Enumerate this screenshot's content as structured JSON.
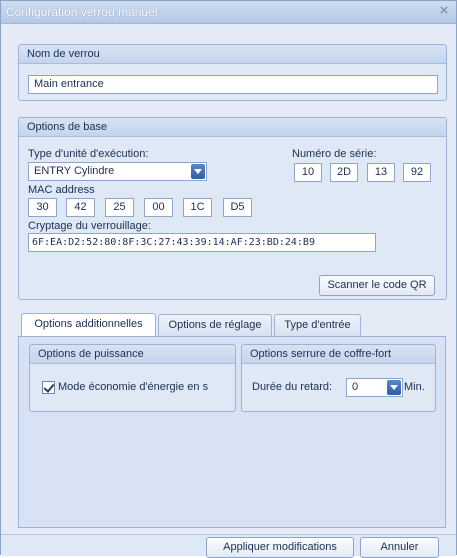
{
  "window": {
    "title": "Configuration verrou manuel",
    "close_glyph": "×"
  },
  "lock_name": {
    "header": "Nom de verrou",
    "value": "Main entrance"
  },
  "basic_options": {
    "header": "Options de base",
    "unit_type_label": "Type d'unité d'exécution:",
    "unit_type_value": "ENTRY Cylindre",
    "serial_label": "Numéro de série:",
    "serial": [
      "10",
      "2D",
      "13",
      "92"
    ],
    "mac_label": "MAC address",
    "mac": [
      "30",
      "42",
      "25",
      "00",
      "1C",
      "D5"
    ],
    "crypt_label": "Cryptage du verrouillage:",
    "crypt_value": "6F:EA:D2:52:80:8F:3C:27:43:39:14:AF:23:BD:24:B9",
    "scan_button": "Scanner le code QR"
  },
  "tabs": [
    {
      "label": "Options additionnelles",
      "active": true
    },
    {
      "label": "Options de réglage",
      "active": false
    },
    {
      "label": "Type d'entrée",
      "active": false
    }
  ],
  "power_options": {
    "header": "Options de puissance",
    "energy_saving_label": "Mode économie d'énergie en s",
    "energy_saving_checked": true
  },
  "safe_options": {
    "header": "Options serrure de coffre-fort",
    "delay_label": "Durée du retard:",
    "delay_value": "0",
    "unit": "Min."
  },
  "footer": {
    "apply_button": "Appliquer modifications",
    "cancel_button": "Annuler"
  },
  "icons": {
    "close": "close-icon",
    "dropdown": "chevron-down-icon",
    "check": "checkmark-icon"
  }
}
